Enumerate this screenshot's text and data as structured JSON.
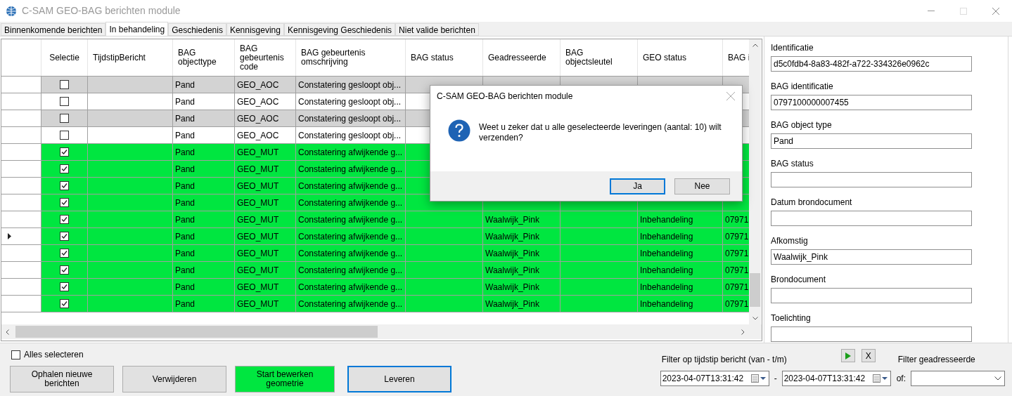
{
  "window": {
    "title": "C-SAM GEO-BAG berichten module"
  },
  "tabs": [
    {
      "label": "Binnenkomende berichten",
      "selected": false
    },
    {
      "label": "In behandeling",
      "selected": true
    },
    {
      "label": "Geschiedenis",
      "selected": false
    },
    {
      "label": "Kennisgeving",
      "selected": false
    },
    {
      "label": "Kennisgeving Geschiedenis",
      "selected": false
    },
    {
      "label": "Niet valide berichten",
      "selected": false
    }
  ],
  "grid": {
    "columns": [
      "Selectie",
      "TijdstipBericht",
      "BAG objecttype",
      "BAG gebeurtenis code",
      "BAG gebeurtenis omschrijving",
      "BAG status",
      "Geadresseerde",
      "BAG objectsleutel",
      "GEO status",
      "BAG i"
    ],
    "rows": [
      {
        "current": false,
        "checked": false,
        "color": "#d3d3d3",
        "cells": [
          null,
          null,
          "Pand",
          "GEO_AOC",
          "Constatering gesloopt obj...",
          null,
          null,
          null,
          null,
          null
        ]
      },
      {
        "current": false,
        "checked": false,
        "color": "#ffffff",
        "cells": [
          null,
          null,
          "Pand",
          "GEO_AOC",
          "Constatering gesloopt obj...",
          null,
          null,
          null,
          null,
          null
        ]
      },
      {
        "current": false,
        "checked": false,
        "color": "#d3d3d3",
        "cells": [
          null,
          null,
          "Pand",
          "GEO_AOC",
          "Constatering gesloopt obj...",
          null,
          null,
          null,
          null,
          null
        ]
      },
      {
        "current": false,
        "checked": false,
        "color": "#ffffff",
        "cells": [
          null,
          null,
          "Pand",
          "GEO_AOC",
          "Constatering gesloopt obj...",
          null,
          null,
          null,
          null,
          null
        ]
      },
      {
        "current": false,
        "checked": true,
        "color": "#00e640",
        "cells": [
          null,
          null,
          "Pand",
          "GEO_MUT",
          "Constatering afwijkende g...",
          null,
          null,
          null,
          null,
          null
        ]
      },
      {
        "current": false,
        "checked": true,
        "color": "#00e640",
        "cells": [
          null,
          null,
          "Pand",
          "GEO_MUT",
          "Constatering afwijkende g...",
          null,
          null,
          null,
          null,
          null
        ]
      },
      {
        "current": false,
        "checked": true,
        "color": "#00e640",
        "cells": [
          null,
          null,
          "Pand",
          "GEO_MUT",
          "Constatering afwijkende g...",
          null,
          null,
          null,
          null,
          null
        ]
      },
      {
        "current": false,
        "checked": true,
        "color": "#00e640",
        "cells": [
          null,
          null,
          "Pand",
          "GEO_MUT",
          "Constatering afwijkende g...",
          null,
          null,
          null,
          null,
          null
        ]
      },
      {
        "current": false,
        "checked": true,
        "color": "#00e640",
        "cells": [
          null,
          null,
          "Pand",
          "GEO_MUT",
          "Constatering afwijkende g...",
          null,
          "Waalwijk_Pink",
          null,
          "Inbehandeling",
          "07971"
        ]
      },
      {
        "current": true,
        "checked": true,
        "color": "#00e640",
        "cells": [
          null,
          null,
          "Pand",
          "GEO_MUT",
          "Constatering afwijkende g...",
          null,
          "Waalwijk_Pink",
          null,
          "Inbehandeling",
          "07971"
        ]
      },
      {
        "current": false,
        "checked": true,
        "color": "#00e640",
        "cells": [
          null,
          null,
          "Pand",
          "GEO_MUT",
          "Constatering afwijkende g...",
          null,
          "Waalwijk_Pink",
          null,
          "Inbehandeling",
          "07971"
        ]
      },
      {
        "current": false,
        "checked": true,
        "color": "#00e640",
        "cells": [
          null,
          null,
          "Pand",
          "GEO_MUT",
          "Constatering afwijkende g...",
          null,
          "Waalwijk_Pink",
          null,
          "Inbehandeling",
          "07971"
        ]
      },
      {
        "current": false,
        "checked": true,
        "color": "#00e640",
        "cells": [
          null,
          null,
          "Pand",
          "GEO_MUT",
          "Constatering afwijkende g...",
          null,
          "Waalwijk_Pink",
          null,
          "Inbehandeling",
          "07971"
        ]
      },
      {
        "current": false,
        "checked": true,
        "color": "#00e640",
        "cells": [
          null,
          null,
          "Pand",
          "GEO_MUT",
          "Constatering afwijkende g...",
          null,
          "Waalwijk_Pink",
          null,
          "Inbehandeling",
          "07971"
        ]
      }
    ]
  },
  "details": [
    {
      "label": "Identificatie",
      "value": "d5c0fdb4-8a83-482f-a722-334326e0962c"
    },
    {
      "label": "BAG identificatie",
      "value": "0797100000007455"
    },
    {
      "label": "BAG object type",
      "value": "Pand"
    },
    {
      "label": "BAG status"
    },
    {
      "label": "Datum brondocument"
    },
    {
      "label": "Afkomstig",
      "value": "Waalwijk_Pink"
    },
    {
      "label": "Brondocument"
    },
    {
      "label": "Toelichting"
    }
  ],
  "select_all": {
    "label": "Alles selecteren",
    "checked": false
  },
  "buttons": [
    {
      "label": "Ophalen nieuwe berichten",
      "kind": "plain"
    },
    {
      "label": "Verwijderen",
      "kind": "plain"
    },
    {
      "label": "Start bewerken geometrie",
      "kind": "green"
    },
    {
      "label": "Leveren",
      "kind": "default"
    }
  ],
  "filter": {
    "label": "Filter op tijdstip bericht (van - t/m)",
    "clear": "X",
    "from": "2023-04-07T13:31:42",
    "separator": "-",
    "to": "2023-04-07T13:31:42",
    "or_label": "of:",
    "addressee_label": "Filter geadresseerde"
  },
  "dialog": {
    "title": "C-SAM GEO-BAG berichten module",
    "message": "Weet u zeker dat u alle geselecteerde leveringen (aantal: 10) wilt verzenden?",
    "buttons": [
      {
        "label": "Ja",
        "focused": true
      },
      {
        "label": "Nee",
        "focused": false
      }
    ]
  }
}
